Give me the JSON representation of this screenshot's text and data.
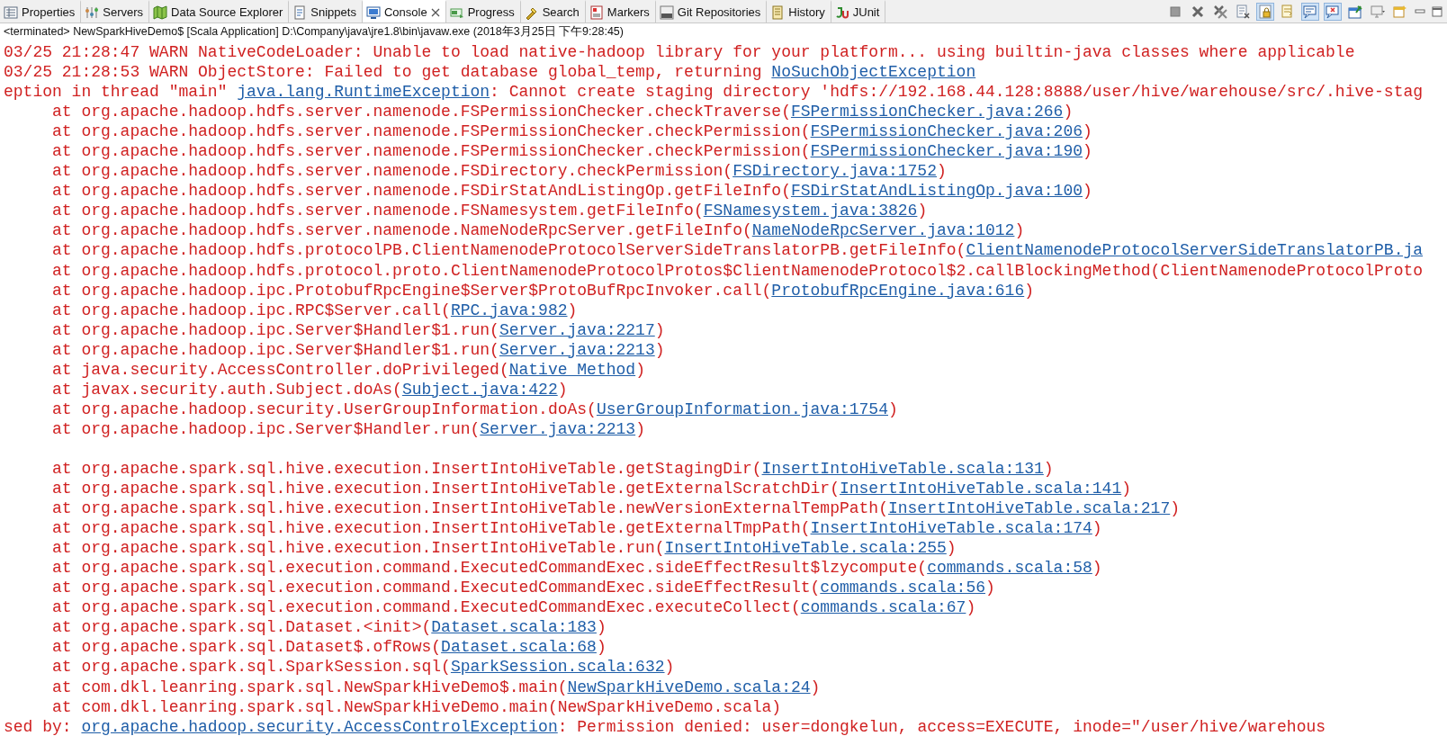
{
  "tabs": [
    {
      "label": "Properties",
      "selected": false
    },
    {
      "label": "Servers",
      "selected": false
    },
    {
      "label": "Data Source Explorer",
      "selected": false
    },
    {
      "label": "Snippets",
      "selected": false
    },
    {
      "label": "Console",
      "selected": true
    },
    {
      "label": "Progress",
      "selected": false
    },
    {
      "label": "Search",
      "selected": false
    },
    {
      "label": "Markers",
      "selected": false
    },
    {
      "label": "Git Repositories",
      "selected": false
    },
    {
      "label": "History",
      "selected": false
    },
    {
      "label": "JUnit",
      "selected": false
    }
  ],
  "toolbar": [
    {
      "pressed": false
    },
    {
      "pressed": false
    },
    {
      "pressed": false
    },
    {
      "pressed": false
    },
    {
      "pressed": true
    },
    {
      "pressed": false
    },
    {
      "pressed": true
    },
    {
      "pressed": true
    },
    {
      "pressed": false
    },
    {
      "pressed": false
    },
    {
      "pressed": false
    }
  ],
  "process_label": "<terminated> NewSparkHiveDemo$ [Scala Application] D:\\Company\\java\\jre1.8\\bin\\javaw.exe (2018年3月25日 下午9:28:45)",
  "console_lines": [
    {
      "kind": "output",
      "parts": [
        {
          "kind": "text",
          "text": "03/25 21:28:47 WARN NativeCodeLoader: Unable to load native-hadoop library for your platform... using builtin-java classes where applicable"
        }
      ]
    },
    {
      "kind": "output",
      "parts": [
        {
          "kind": "text",
          "text": "03/25 21:28:53 WARN ObjectStore: Failed to get database global_temp, returning "
        },
        {
          "kind": "link",
          "text": "NoSuchObjectException"
        }
      ]
    },
    {
      "kind": "output",
      "parts": [
        {
          "kind": "text",
          "text": "eption in thread \"main\" "
        },
        {
          "kind": "link",
          "text": "java.lang.RuntimeException"
        },
        {
          "kind": "text",
          "text": ": Cannot create staging directory 'hdfs://192.168.44.128:8888/user/hive/warehouse/src/.hive-stag"
        }
      ]
    },
    {
      "kind": "output",
      "parts": [
        {
          "kind": "text",
          "text": "     at org.apache.hadoop.hdfs.server.namenode.FSPermissionChecker.checkTraverse("
        },
        {
          "kind": "link",
          "text": "FSPermissionChecker.java:266"
        },
        {
          "kind": "text",
          "text": ")"
        }
      ]
    },
    {
      "kind": "output",
      "parts": [
        {
          "kind": "text",
          "text": "     at org.apache.hadoop.hdfs.server.namenode.FSPermissionChecker.checkPermission("
        },
        {
          "kind": "link",
          "text": "FSPermissionChecker.java:206"
        },
        {
          "kind": "text",
          "text": ")"
        }
      ]
    },
    {
      "kind": "output",
      "parts": [
        {
          "kind": "text",
          "text": "     at org.apache.hadoop.hdfs.server.namenode.FSPermissionChecker.checkPermission("
        },
        {
          "kind": "link",
          "text": "FSPermissionChecker.java:190"
        },
        {
          "kind": "text",
          "text": ")"
        }
      ]
    },
    {
      "kind": "output",
      "parts": [
        {
          "kind": "text",
          "text": "     at org.apache.hadoop.hdfs.server.namenode.FSDirectory.checkPermission("
        },
        {
          "kind": "link",
          "text": "FSDirectory.java:1752"
        },
        {
          "kind": "text",
          "text": ")"
        }
      ]
    },
    {
      "kind": "output",
      "parts": [
        {
          "kind": "text",
          "text": "     at org.apache.hadoop.hdfs.server.namenode.FSDirStatAndListingOp.getFileInfo("
        },
        {
          "kind": "link",
          "text": "FSDirStatAndListingOp.java:100"
        },
        {
          "kind": "text",
          "text": ")"
        }
      ]
    },
    {
      "kind": "output",
      "parts": [
        {
          "kind": "text",
          "text": "     at org.apache.hadoop.hdfs.server.namenode.FSNamesystem.getFileInfo("
        },
        {
          "kind": "link",
          "text": "FSNamesystem.java:3826"
        },
        {
          "kind": "text",
          "text": ")"
        }
      ]
    },
    {
      "kind": "output",
      "parts": [
        {
          "kind": "text",
          "text": "     at org.apache.hadoop.hdfs.server.namenode.NameNodeRpcServer.getFileInfo("
        },
        {
          "kind": "link",
          "text": "NameNodeRpcServer.java:1012"
        },
        {
          "kind": "text",
          "text": ")"
        }
      ]
    },
    {
      "kind": "output",
      "parts": [
        {
          "kind": "text",
          "text": "     at org.apache.hadoop.hdfs.protocolPB.ClientNamenodeProtocolServerSideTranslatorPB.getFileInfo("
        },
        {
          "kind": "link",
          "text": "ClientNamenodeProtocolServerSideTranslatorPB.ja"
        }
      ]
    },
    {
      "kind": "output",
      "parts": [
        {
          "kind": "text",
          "text": "     at org.apache.hadoop.hdfs.protocol.proto.ClientNamenodeProtocolProtos$ClientNamenodeProtocol$2.callBlockingMethod(ClientNamenodeProtocolProto"
        }
      ]
    },
    {
      "kind": "output",
      "parts": [
        {
          "kind": "text",
          "text": "     at org.apache.hadoop.ipc.ProtobufRpcEngine$Server$ProtoBufRpcInvoker.call("
        },
        {
          "kind": "link",
          "text": "ProtobufRpcEngine.java:616"
        },
        {
          "kind": "text",
          "text": ")"
        }
      ]
    },
    {
      "kind": "output",
      "parts": [
        {
          "kind": "text",
          "text": "     at org.apache.hadoop.ipc.RPC$Server.call("
        },
        {
          "kind": "link",
          "text": "RPC.java:982"
        },
        {
          "kind": "text",
          "text": ")"
        }
      ]
    },
    {
      "kind": "output",
      "parts": [
        {
          "kind": "text",
          "text": "     at org.apache.hadoop.ipc.Server$Handler$1.run("
        },
        {
          "kind": "link",
          "text": "Server.java:2217"
        },
        {
          "kind": "text",
          "text": ")"
        }
      ]
    },
    {
      "kind": "output",
      "parts": [
        {
          "kind": "text",
          "text": "     at org.apache.hadoop.ipc.Server$Handler$1.run("
        },
        {
          "kind": "link",
          "text": "Server.java:2213"
        },
        {
          "kind": "text",
          "text": ")"
        }
      ]
    },
    {
      "kind": "output",
      "parts": [
        {
          "kind": "text",
          "text": "     at java.security.AccessController.doPrivileged("
        },
        {
          "kind": "link",
          "text": "Native Method"
        },
        {
          "kind": "text",
          "text": ")"
        }
      ]
    },
    {
      "kind": "output",
      "parts": [
        {
          "kind": "text",
          "text": "     at javax.security.auth.Subject.doAs("
        },
        {
          "kind": "link",
          "text": "Subject.java:422"
        },
        {
          "kind": "text",
          "text": ")"
        }
      ]
    },
    {
      "kind": "output",
      "parts": [
        {
          "kind": "text",
          "text": "     at org.apache.hadoop.security.UserGroupInformation.doAs("
        },
        {
          "kind": "link",
          "text": "UserGroupInformation.java:1754"
        },
        {
          "kind": "text",
          "text": ")"
        }
      ]
    },
    {
      "kind": "output",
      "parts": [
        {
          "kind": "text",
          "text": "     at org.apache.hadoop.ipc.Server$Handler.run("
        },
        {
          "kind": "link",
          "text": "Server.java:2213"
        },
        {
          "kind": "text",
          "text": ")"
        }
      ]
    },
    {
      "kind": "blank"
    },
    {
      "kind": "output",
      "parts": [
        {
          "kind": "text",
          "text": "     at org.apache.spark.sql.hive.execution.InsertIntoHiveTable.getStagingDir("
        },
        {
          "kind": "link",
          "text": "InsertIntoHiveTable.scala:131"
        },
        {
          "kind": "text",
          "text": ")"
        }
      ]
    },
    {
      "kind": "output",
      "parts": [
        {
          "kind": "text",
          "text": "     at org.apache.spark.sql.hive.execution.InsertIntoHiveTable.getExternalScratchDir("
        },
        {
          "kind": "link",
          "text": "InsertIntoHiveTable.scala:141"
        },
        {
          "kind": "text",
          "text": ")"
        }
      ]
    },
    {
      "kind": "output",
      "parts": [
        {
          "kind": "text",
          "text": "     at org.apache.spark.sql.hive.execution.InsertIntoHiveTable.newVersionExternalTempPath("
        },
        {
          "kind": "link",
          "text": "InsertIntoHiveTable.scala:217"
        },
        {
          "kind": "text",
          "text": ")"
        }
      ]
    },
    {
      "kind": "output",
      "parts": [
        {
          "kind": "text",
          "text": "     at org.apache.spark.sql.hive.execution.InsertIntoHiveTable.getExternalTmpPath("
        },
        {
          "kind": "link",
          "text": "InsertIntoHiveTable.scala:174"
        },
        {
          "kind": "text",
          "text": ")"
        }
      ]
    },
    {
      "kind": "output",
      "parts": [
        {
          "kind": "text",
          "text": "     at org.apache.spark.sql.hive.execution.InsertIntoHiveTable.run("
        },
        {
          "kind": "link",
          "text": "InsertIntoHiveTable.scala:255"
        },
        {
          "kind": "text",
          "text": ")"
        }
      ]
    },
    {
      "kind": "output",
      "parts": [
        {
          "kind": "text",
          "text": "     at org.apache.spark.sql.execution.command.ExecutedCommandExec.sideEffectResult$lzycompute("
        },
        {
          "kind": "link",
          "text": "commands.scala:58"
        },
        {
          "kind": "text",
          "text": ")"
        }
      ]
    },
    {
      "kind": "output",
      "parts": [
        {
          "kind": "text",
          "text": "     at org.apache.spark.sql.execution.command.ExecutedCommandExec.sideEffectResult("
        },
        {
          "kind": "link",
          "text": "commands.scala:56"
        },
        {
          "kind": "text",
          "text": ")"
        }
      ]
    },
    {
      "kind": "output",
      "parts": [
        {
          "kind": "text",
          "text": "     at org.apache.spark.sql.execution.command.ExecutedCommandExec.executeCollect("
        },
        {
          "kind": "link",
          "text": "commands.scala:67"
        },
        {
          "kind": "text",
          "text": ")"
        }
      ]
    },
    {
      "kind": "output",
      "parts": [
        {
          "kind": "text",
          "text": "     at org.apache.spark.sql.Dataset.<init>("
        },
        {
          "kind": "link",
          "text": "Dataset.scala:183"
        },
        {
          "kind": "text",
          "text": ")"
        }
      ]
    },
    {
      "kind": "output",
      "parts": [
        {
          "kind": "text",
          "text": "     at org.apache.spark.sql.Dataset$.ofRows("
        },
        {
          "kind": "link",
          "text": "Dataset.scala:68"
        },
        {
          "kind": "text",
          "text": ")"
        }
      ]
    },
    {
      "kind": "output",
      "parts": [
        {
          "kind": "text",
          "text": "     at org.apache.spark.sql.SparkSession.sql("
        },
        {
          "kind": "link",
          "text": "SparkSession.scala:632"
        },
        {
          "kind": "text",
          "text": ")"
        }
      ]
    },
    {
      "kind": "output",
      "parts": [
        {
          "kind": "text",
          "text": "     at com.dkl.leanring.spark.sql.NewSparkHiveDemo$.main("
        },
        {
          "kind": "link",
          "text": "NewSparkHiveDemo.scala:24"
        },
        {
          "kind": "text",
          "text": ")"
        }
      ]
    },
    {
      "kind": "output",
      "parts": [
        {
          "kind": "text",
          "text": "     at com.dkl.leanring.spark.sql.NewSparkHiveDemo.main(NewSparkHiveDemo.scala)"
        }
      ]
    },
    {
      "kind": "output",
      "parts": [
        {
          "kind": "text",
          "text": "sed by: "
        },
        {
          "kind": "link",
          "text": "org.apache.hadoop.security.AccessControlException"
        },
        {
          "kind": "text",
          "text": ": Permission denied: user=dongkelun, access=EXECUTE, inode=\"/user/hive/warehous"
        }
      ]
    }
  ]
}
